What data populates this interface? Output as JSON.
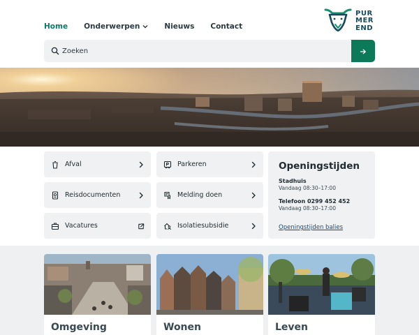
{
  "nav": {
    "items": [
      {
        "label": "Home",
        "active": true
      },
      {
        "label": "Onderwerpen",
        "dropdown": true
      },
      {
        "label": "Nieuws"
      },
      {
        "label": "Contact"
      }
    ]
  },
  "logo": {
    "lines": [
      "PUR",
      "MER",
      "END"
    ],
    "icon": "cow-head-icon"
  },
  "search": {
    "placeholder": "Zoeken",
    "value": "",
    "submit_icon": "arrow-right-icon"
  },
  "hero": {
    "image": "panorama-city-sunset"
  },
  "quick_links": [
    {
      "label": "Afval",
      "icon": "bin-icon",
      "action_icon": "chevron-right-icon"
    },
    {
      "label": "Parkeren",
      "icon": "parking-card-icon",
      "action_icon": "chevron-right-icon"
    },
    {
      "label": "Reisdocumenten",
      "icon": "passport-icon",
      "action_icon": "chevron-right-icon"
    },
    {
      "label": "Melding doen",
      "icon": "report-icon",
      "action_icon": "chevron-right-icon"
    },
    {
      "label": "Vacatures",
      "icon": "briefcase-icon",
      "action_icon": "external-link-icon"
    },
    {
      "label": "Isolatiesubsidie",
      "icon": "house-person-icon",
      "action_icon": "chevron-right-icon"
    }
  ],
  "opening_hours": {
    "title": "Openingstijden",
    "blocks": [
      {
        "title": "Stadhuis",
        "hours": "Vandaag 08:30–17:00"
      },
      {
        "title": "Telefoon 0299 452 452",
        "hours": "Vandaag 08:30–17:00"
      }
    ],
    "link": "Openingstijden balies"
  },
  "cards": [
    {
      "title": "Omgeving",
      "image": "town-square-aerial"
    },
    {
      "title": "Wonen",
      "image": "canal-houses"
    },
    {
      "title": "Leven",
      "image": "festival-drummer"
    }
  ],
  "colors": {
    "accent": "#0b7a63",
    "button": "#0c7a58",
    "logo": "#174a5c",
    "panel": "#f0f1f2"
  }
}
